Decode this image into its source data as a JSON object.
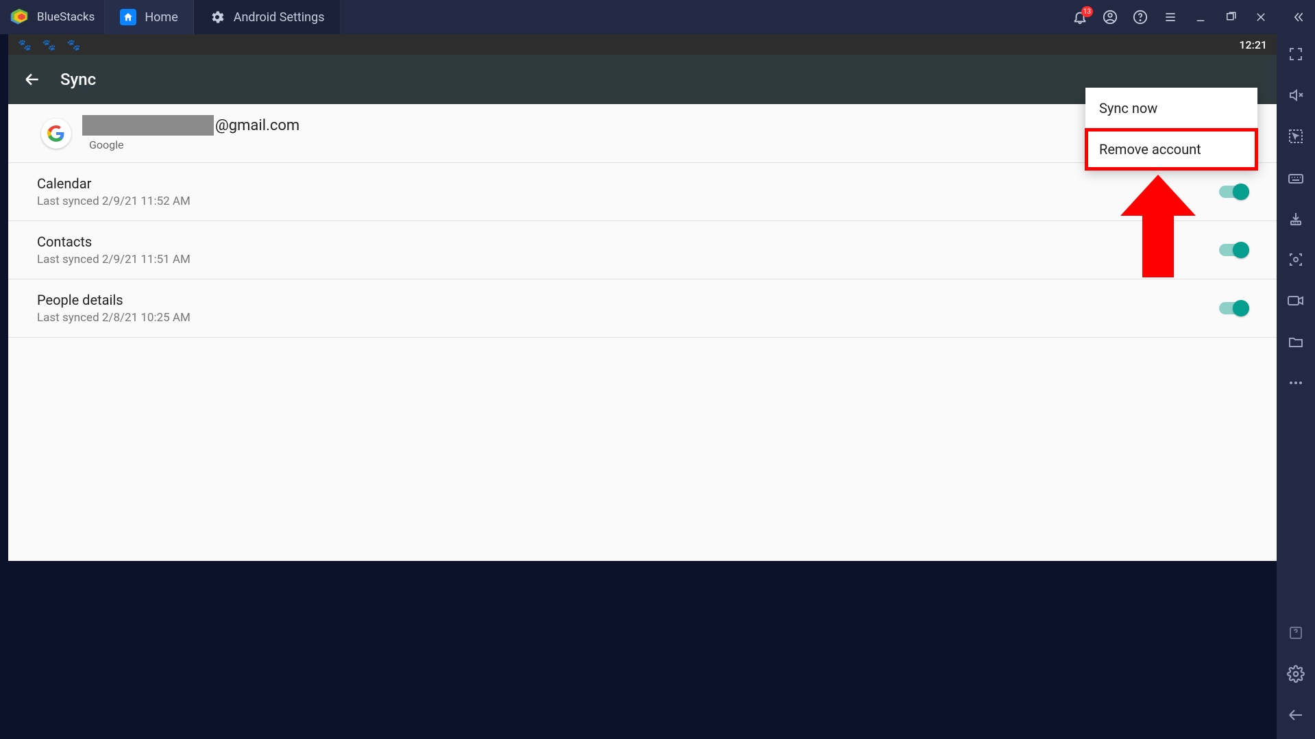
{
  "topbar": {
    "brand": "BlueStacks",
    "tabs": [
      {
        "label": "Home"
      },
      {
        "label": "Android Settings"
      }
    ],
    "notification_count": "13"
  },
  "android": {
    "status_time": "12:21",
    "appbar_title": "Sync",
    "account": {
      "email_suffix": "@gmail.com",
      "provider": "Google"
    },
    "sync_items": [
      {
        "title": "Calendar",
        "sub": "Last synced 2/9/21 11:52 AM"
      },
      {
        "title": "Contacts",
        "sub": "Last synced 2/9/21 11:51 AM"
      },
      {
        "title": "People details",
        "sub": "Last synced 2/8/21 10:25 AM"
      }
    ],
    "popup": {
      "sync_now": "Sync now",
      "remove_account": "Remove account"
    }
  }
}
